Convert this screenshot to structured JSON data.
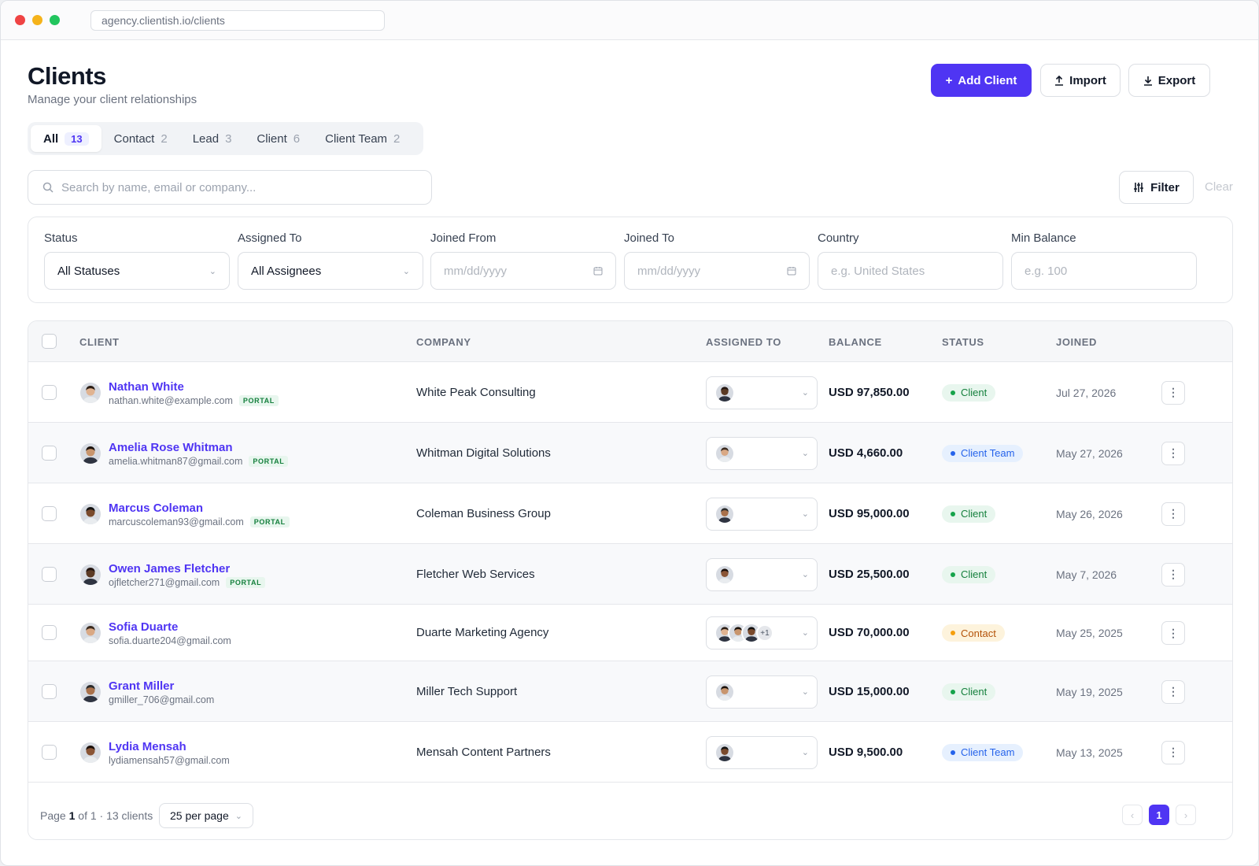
{
  "browser": {
    "url": "agency.clientish.io/clients"
  },
  "header": {
    "title": "Clients",
    "subtitle": "Manage your client relationships",
    "add_label": "Add Client",
    "import_label": "Import",
    "export_label": "Export",
    "colors": {
      "accent": "#4f35f3"
    }
  },
  "tabs": [
    {
      "label": "All",
      "count": "13"
    },
    {
      "label": "Contact",
      "count": "2"
    },
    {
      "label": "Lead",
      "count": "3"
    },
    {
      "label": "Client",
      "count": "6"
    },
    {
      "label": "Client Team",
      "count": "2"
    }
  ],
  "search": {
    "placeholder": "Search by name, email or company..."
  },
  "toolbar": {
    "filter_label": "Filter",
    "clear_label": "Clear"
  },
  "filters": {
    "status": {
      "label": "Status",
      "value": "All Statuses"
    },
    "assigned": {
      "label": "Assigned To",
      "value": "All Assignees"
    },
    "joined_from": {
      "label": "Joined From",
      "placeholder": "mm/dd/yyyy"
    },
    "joined_to": {
      "label": "Joined To",
      "placeholder": "mm/dd/yyyy"
    },
    "country": {
      "label": "Country",
      "placeholder": "e.g. United States"
    },
    "min_balance": {
      "label": "Min Balance",
      "placeholder": "e.g. 100"
    }
  },
  "table": {
    "headers": {
      "client": "CLIENT",
      "company": "COMPANY",
      "assigned": "ASSIGNED TO",
      "balance": "BALANCE",
      "status": "STATUS",
      "joined": "JOINED"
    },
    "portal_label": "PORTAL",
    "rows": [
      {
        "name": "Nathan White",
        "email": "nathan.white@example.com",
        "portal": true,
        "company": "White Peak Consulting",
        "assignees": 1,
        "extra": "",
        "balance": "USD 97,850.00",
        "status": "Client",
        "joined": "Jul 27, 2026"
      },
      {
        "name": "Amelia Rose Whitman",
        "email": "amelia.whitman87@gmail.com",
        "portal": true,
        "company": "Whitman Digital Solutions",
        "assignees": 1,
        "extra": "",
        "balance": "USD 4,660.00",
        "status": "Client Team",
        "joined": "May 27, 2026"
      },
      {
        "name": "Marcus Coleman",
        "email": "marcuscoleman93@gmail.com",
        "portal": true,
        "company": "Coleman Business Group",
        "assignees": 1,
        "extra": "",
        "balance": "USD 95,000.00",
        "status": "Client",
        "joined": "May 26, 2026"
      },
      {
        "name": "Owen James Fletcher",
        "email": "ojfletcher271@gmail.com",
        "portal": true,
        "company": "Fletcher Web Services",
        "assignees": 1,
        "extra": "",
        "balance": "USD 25,500.00",
        "status": "Client",
        "joined": "May 7, 2026"
      },
      {
        "name": "Sofia Duarte",
        "email": "sofia.duarte204@gmail.com",
        "portal": false,
        "company": "Duarte Marketing Agency",
        "assignees": 3,
        "extra": "+1",
        "balance": "USD 70,000.00",
        "status": "Contact",
        "joined": "May 25, 2025"
      },
      {
        "name": "Grant Miller",
        "email": "gmiller_706@gmail.com",
        "portal": false,
        "company": "Miller Tech Support",
        "assignees": 1,
        "extra": "",
        "balance": "USD 15,000.00",
        "status": "Client",
        "joined": "May 19, 2025"
      },
      {
        "name": "Lydia Mensah",
        "email": "lydiamensah57@gmail.com",
        "portal": false,
        "company": "Mensah Content Partners",
        "assignees": 1,
        "extra": "",
        "balance": "USD 9,500.00",
        "status": "Client Team",
        "joined": "May 13, 2025"
      }
    ]
  },
  "status_styles": {
    "Client": {
      "bg": "#e8f6ee",
      "fg": "#15803d",
      "dot": "#16a34a"
    },
    "Client Team": {
      "bg": "#e6f0fe",
      "fg": "#2563eb",
      "dot": "#2563eb"
    },
    "Contact": {
      "bg": "#fdf3dc",
      "fg": "#b45309",
      "dot": "#f59e0b"
    }
  },
  "pagination": {
    "page_prefix": "Page",
    "page": "1",
    "of_text": "of 1 · 13 clients",
    "per_page": "25 per page",
    "current": "1"
  }
}
